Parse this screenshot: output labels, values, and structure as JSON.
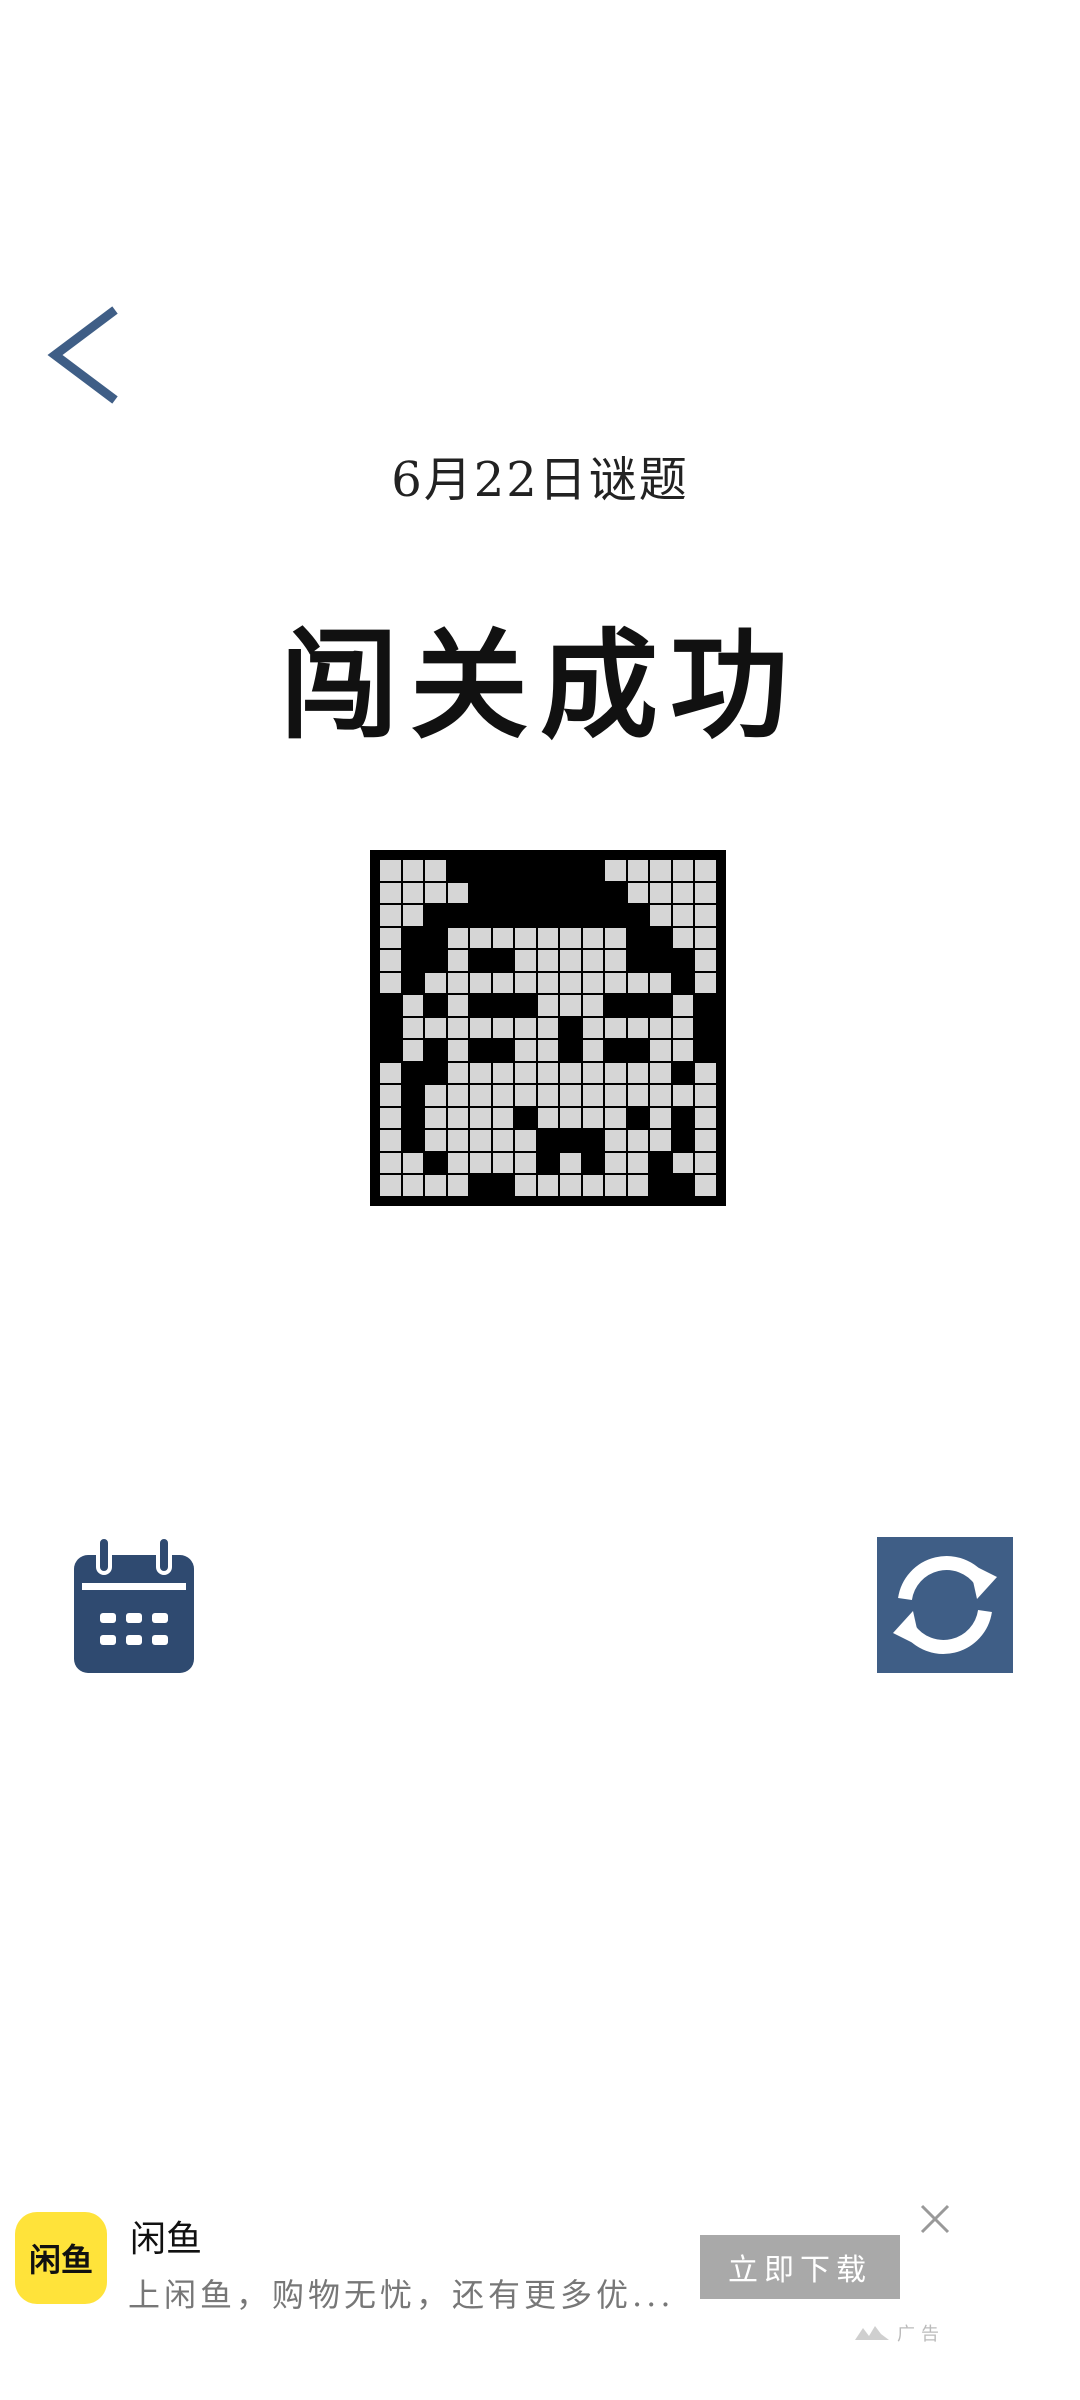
{
  "header": {
    "date_title": "6月22日谜题",
    "success_title": "闯关成功"
  },
  "puzzle": {
    "rows": 15,
    "cols": 15,
    "filled": [
      "...#######.....",
      "....#######....",
      "..##########...",
      ".##........##..",
      ".##.##.....###.",
      ".#...........#.",
      "#.#.###...###.#",
      "#.......#.....#",
      "#.#.##..#.##..#",
      ".##..........#.",
      ".#.............",
      ".#....#....#.#.",
      ".#.....###...#.",
      "..#....#.#..#..",
      "....##......##.",
      "....######....."
    ]
  },
  "icons": {
    "back": "chevron-left-icon",
    "calendar": "calendar-icon",
    "refresh": "refresh-icon",
    "close": "close-icon"
  },
  "colors": {
    "accent": "#3f5e86",
    "calendar_fill": "#2f4a70",
    "cell_empty": "#d6d6d6",
    "cell_filled": "#000000",
    "ad_logo_bg": "#ffe33a"
  },
  "ad": {
    "logo_text": "闲鱼",
    "title": "闲鱼",
    "description": "上闲鱼，购物无忧，还有更多优...",
    "cta_label": "立即下载",
    "label": "广告"
  }
}
